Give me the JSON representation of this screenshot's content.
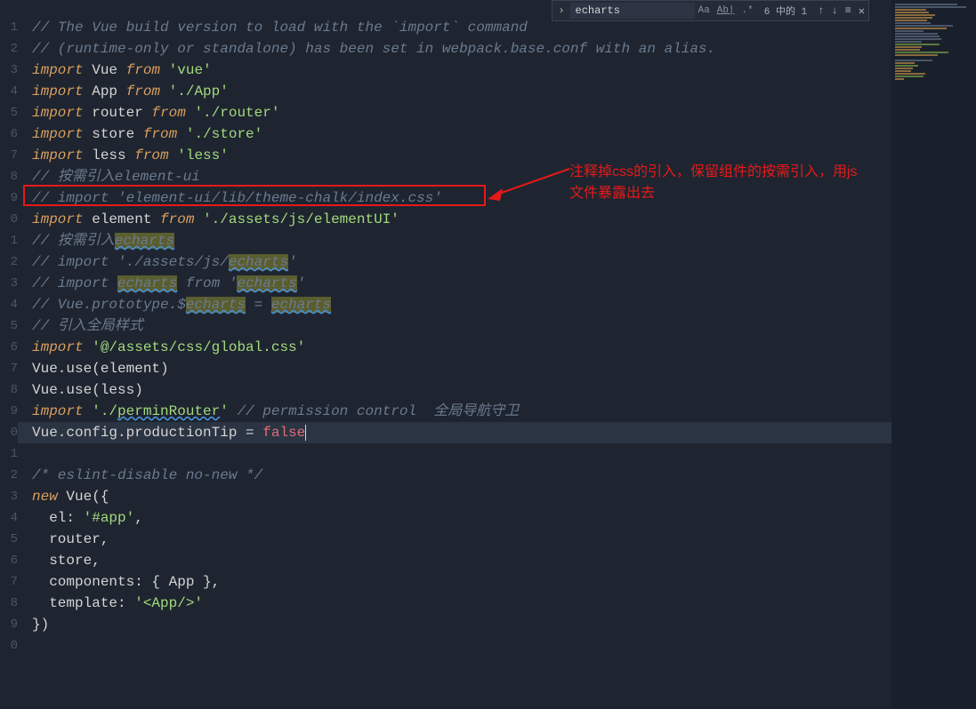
{
  "find": {
    "query": "echarts",
    "result_count": "6 中的 1",
    "options": {
      "case": "Aa",
      "word": "Ab|",
      "regex": ".*"
    }
  },
  "annotation": {
    "line1": "注释掉css的引入，保留组件的按需引入，用js",
    "line2": "文件暴露出去"
  },
  "gutter_start": 1,
  "code": {
    "l1_a": "// The Vue build version to load with the `import` command",
    "l2_a": "// (runtime-only or standalone) has been set in webpack.base.conf with an alias.",
    "l3_kw": "import",
    "l3_id": " Vue ",
    "l3_from": "from",
    "l3_sp": " ",
    "l3_str": "'vue'",
    "l4_kw": "import",
    "l4_id": " App ",
    "l4_from": "from",
    "l4_sp": " ",
    "l4_str": "'./App'",
    "l5_kw": "import",
    "l5_id": " router ",
    "l5_from": "from",
    "l5_sp": " ",
    "l5_str": "'./router'",
    "l6_kw": "import",
    "l6_id": " store ",
    "l6_from": "from",
    "l6_sp": " ",
    "l6_str": "'./store'",
    "l7_kw": "import",
    "l7_id": " less ",
    "l7_from": "from",
    "l7_sp": " ",
    "l7_str": "'less'",
    "l8_a": "// 按需引入element-ui",
    "l9_a": "// import 'element-ui/lib/theme-chalk/index.css'",
    "l10_kw": "import",
    "l10_id": " element ",
    "l10_from": "from",
    "l10_sp": " ",
    "l10_str": "'./assets/js/elementUI'",
    "l11_a": "// 按需引入",
    "l11_hl": "echarts",
    "l12_a": "// import './assets/js/",
    "l12_hl": "echarts",
    "l12_b": "'",
    "l13_a": "// import ",
    "l13_hl1": "echarts",
    "l13_b": " from '",
    "l13_hl2": "echarts",
    "l13_c": "'",
    "l14_a": "// Vue.prototype.$",
    "l14_hl1": "echarts",
    "l14_b": " = ",
    "l14_hl2": "echarts",
    "l15_a": "// 引入全局样式",
    "l16_kw": "import",
    "l16_sp": " ",
    "l16_str": "'@/assets/css/global.css'",
    "l17_a": "Vue.use(element)",
    "l18_a": "Vue.use(less)",
    "l19_kw": "import",
    "l19_sp": " ",
    "l19_str": "'./",
    "l19_ul": "perminRouter",
    "l19_str2": "'",
    "l19_c": " // permission control  全局导航守卫",
    "l20_a": "Vue.config.productionTip = ",
    "l20_false": "false",
    "l22_a": "/* eslint-disable no-new */",
    "l23_kw": "new",
    "l23_id": " Vue({",
    "l24_a": "  el: ",
    "l24_str": "'#app'",
    "l24_b": ",",
    "l25_a": "  router,",
    "l26_a": "  store,",
    "l27_a": "  components: { App },",
    "l28_a": "  template: ",
    "l28_str": "'<App/>'",
    "l29_a": "})"
  }
}
